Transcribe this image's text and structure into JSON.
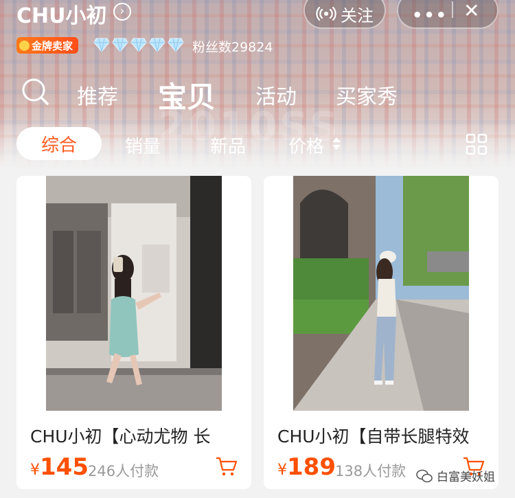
{
  "header": {
    "shop_name": "CHU小初",
    "title_arrow": "›",
    "follow_label": "关注",
    "more_dots": "•••",
    "close_symbol": "✕"
  },
  "badges": {
    "seller_level": "金牌卖家",
    "diamond_count": 5,
    "fans": "粉丝数29824"
  },
  "tabs": [
    {
      "label": "推荐",
      "active": false
    },
    {
      "label": "宝贝",
      "active": true
    },
    {
      "label": "活动",
      "active": false
    },
    {
      "label": "买家秀",
      "active": false
    }
  ],
  "filters": {
    "active": "综合",
    "sales": "销量",
    "new": "新品",
    "price": "价格"
  },
  "products": [
    {
      "title": "CHU小初【心动尤物 长",
      "currency": "¥",
      "price": "145",
      "paid": "246人付款"
    },
    {
      "title": "CHU小初【自带长腿特效",
      "currency": "¥",
      "price": "189",
      "paid": "138人付款"
    }
  ],
  "watermark": {
    "background": "2010SS",
    "account": "白富美妖姐"
  },
  "colors": {
    "accent": "#ff5000",
    "badge": "#ff5a1f"
  },
  "icons": {
    "search": "search-icon",
    "follow": "broadcast-icon",
    "grid": "grid-view-icon",
    "cart": "cart-icon",
    "sort": "sort-arrows-icon"
  }
}
